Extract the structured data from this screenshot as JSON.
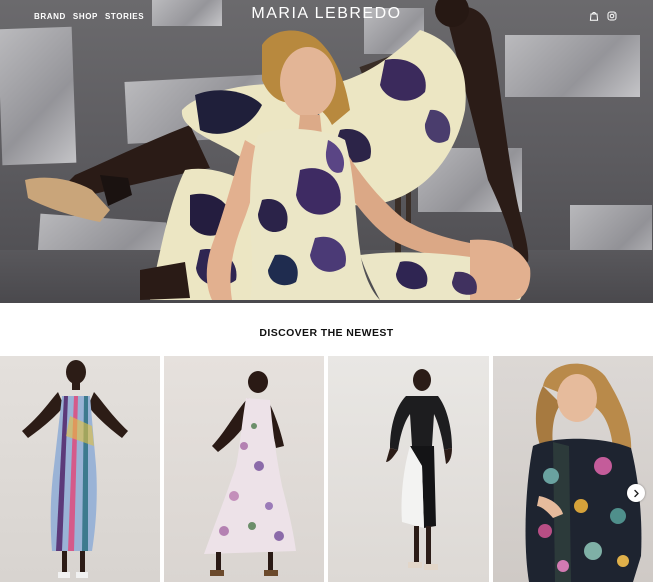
{
  "nav": {
    "links": [
      "BRAND",
      "SHOP",
      "STORIES"
    ],
    "brand": "MARIA LEBREDO",
    "icons": [
      "bag-icon",
      "instagram-icon"
    ]
  },
  "hero": {
    "image": "hero-photo-two-models-in-floral-dresses"
  },
  "section": {
    "title": "DISCOVER THE NEWEST"
  },
  "products": [
    {
      "image": "model-in-striped-multicolor-slip-dress"
    },
    {
      "image": "model-in-pink-floral-slip-dress"
    },
    {
      "image": "model-in-black-and-white-dress"
    },
    {
      "image": "model-in-dark-floral-shirt-dress"
    }
  ],
  "carousel": {
    "next_icon": "chevron-right-icon"
  },
  "colors": {
    "hero_bg": "#5d5c60",
    "card_bg": "#e6e2de",
    "text": "#111111",
    "nav_text": "#ffffff"
  }
}
